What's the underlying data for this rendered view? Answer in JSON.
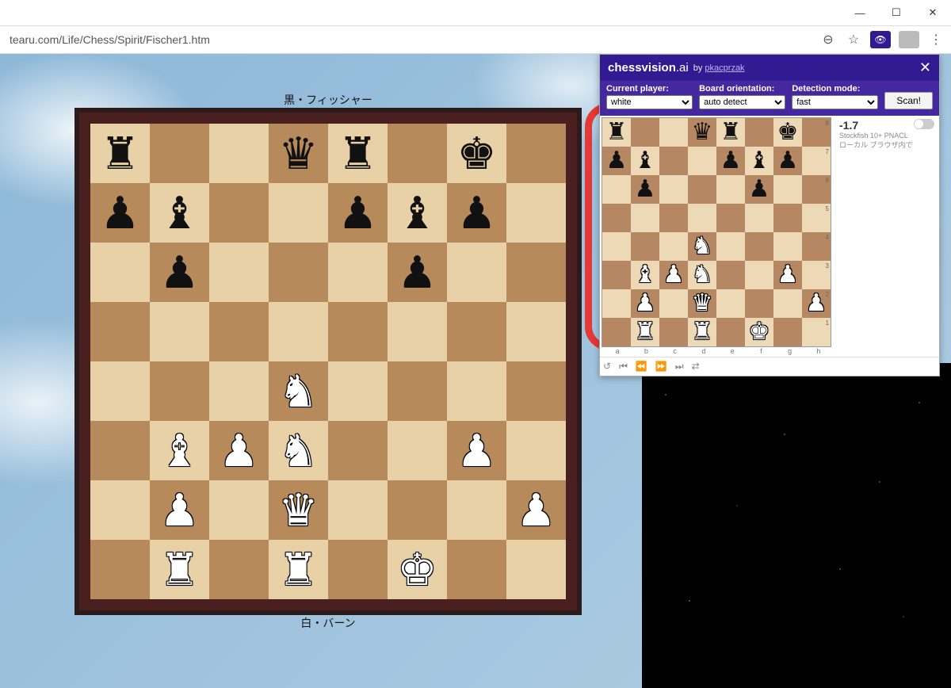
{
  "window": {
    "min": "—",
    "max": "☐",
    "close": "✕"
  },
  "browser": {
    "url": "tearu.com/Life/Chess/Spirit/Fischer1.htm",
    "icons": {
      "zoom": "⊖",
      "star": "☆",
      "menu": "⋮"
    }
  },
  "players": {
    "black": "黒・フィッシャー",
    "white": "白・バーン"
  },
  "main_board": {
    "rows": [
      [
        "r",
        "",
        "",
        "q",
        "r",
        "",
        "k",
        ""
      ],
      [
        "p",
        "b",
        "",
        "",
        "p",
        "b",
        "p",
        ""
      ],
      [
        "",
        "p",
        "",
        "",
        "",
        "p",
        "",
        ""
      ],
      [
        "",
        "",
        "",
        "",
        "",
        "",
        "",
        ""
      ],
      [
        "",
        "",
        "",
        "N",
        "",
        "",
        "",
        ""
      ],
      [
        "",
        "B",
        "P",
        "N",
        "",
        "",
        "P",
        ""
      ],
      [
        "",
        "P",
        "",
        "Q",
        "",
        "",
        "",
        "P"
      ],
      [
        "",
        "R",
        "",
        "R",
        "",
        "K",
        "",
        ""
      ]
    ]
  },
  "extension": {
    "brand": "chessvision",
    "brand_suffix": ".ai",
    "by_prefix": "by ",
    "author": "pkacprzak",
    "close": "✕",
    "labels": {
      "player": "Current player:",
      "orient": "Board orientation:",
      "mode": "Detection mode:"
    },
    "selects": {
      "player": "white",
      "orient": "auto detect",
      "mode": "fast"
    },
    "scan": "Scan!",
    "eval": {
      "score": "-1.7",
      "engine": "Stockfish 10+ PNACL",
      "note": "ローカル ブラウザ内で"
    },
    "files": [
      "a",
      "b",
      "c",
      "d",
      "e",
      "f",
      "g",
      "h"
    ],
    "ranks": [
      "8",
      "7",
      "6",
      "5",
      "4",
      "3",
      "2",
      "1"
    ],
    "mini_board": {
      "rows": [
        [
          "r",
          "",
          "",
          "q",
          "r",
          "",
          "k",
          ""
        ],
        [
          "p",
          "b",
          "",
          "",
          "p",
          "b",
          "p",
          ""
        ],
        [
          "",
          "p",
          "",
          "",
          "",
          "p",
          "",
          ""
        ],
        [
          "",
          "",
          "",
          "",
          "",
          "",
          "",
          ""
        ],
        [
          "",
          "",
          "",
          "N",
          "",
          "",
          "",
          ""
        ],
        [
          "",
          "B",
          "P",
          "N",
          "",
          "",
          "P",
          ""
        ],
        [
          "",
          "P",
          "",
          "Q",
          "",
          "",
          "",
          "P"
        ],
        [
          "",
          "R",
          "",
          "R",
          "",
          "K",
          "",
          ""
        ]
      ]
    },
    "media": [
      "↺",
      "⏮",
      "⏪",
      "⏩",
      "⏭",
      "⇄"
    ]
  }
}
